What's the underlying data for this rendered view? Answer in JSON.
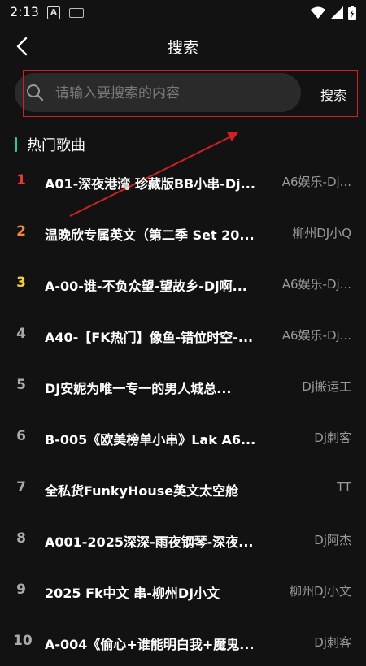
{
  "status": {
    "time": "2:13"
  },
  "header": {
    "title": "搜索"
  },
  "search": {
    "placeholder": "请输入要搜索的内容",
    "button_label": "搜索"
  },
  "hot": {
    "title": "热门歌曲",
    "items": [
      {
        "rank": "1",
        "song": "A01-深夜港湾 珍藏版BB小串-Dj...",
        "artist": "A6娱乐-Dj..."
      },
      {
        "rank": "2",
        "song": "温晚欣专属英文（第二季 Set 20...",
        "artist": "柳州DJ小Q"
      },
      {
        "rank": "3",
        "song": "A-00-谁-不负众望-望故乡-Dj啊...",
        "artist": "A6娱乐-Dj..."
      },
      {
        "rank": "4",
        "song": "A40-【FK热门】像鱼-错位时空-...",
        "artist": "A6娱乐-Dj..."
      },
      {
        "rank": "5",
        "song": "DJ安妮为唯一专一的男人城总...",
        "artist": "Dj搬运工"
      },
      {
        "rank": "6",
        "song": "B-005《欧美榜单小串》Lak A6...",
        "artist": "Dj刺客"
      },
      {
        "rank": "7",
        "song": "全私货FunkyHouse英文太空舱",
        "artist": "TT"
      },
      {
        "rank": "8",
        "song": "A001-2025深深-雨夜钢琴-深夜...",
        "artist": "Dj阿杰"
      },
      {
        "rank": "9",
        "song": "2025 Fk中文 串-柳州DJ小文",
        "artist": "柳州DJ小文"
      },
      {
        "rank": "10",
        "song": "A-004《偷心+谁能明白我+魔鬼...",
        "artist": "Dj刺客"
      }
    ]
  },
  "icons": {
    "back": "back-arrow-icon",
    "search": "search-icon",
    "wifi": "wifi-icon",
    "signal": "signal-icon",
    "battery": "battery-icon"
  },
  "colors": {
    "background": "#121212",
    "accent": "#2ec4a6",
    "rank1": "#e53935",
    "rank2": "#f08a3c",
    "rank3": "#f4d03f",
    "annotation": "#d02020"
  }
}
